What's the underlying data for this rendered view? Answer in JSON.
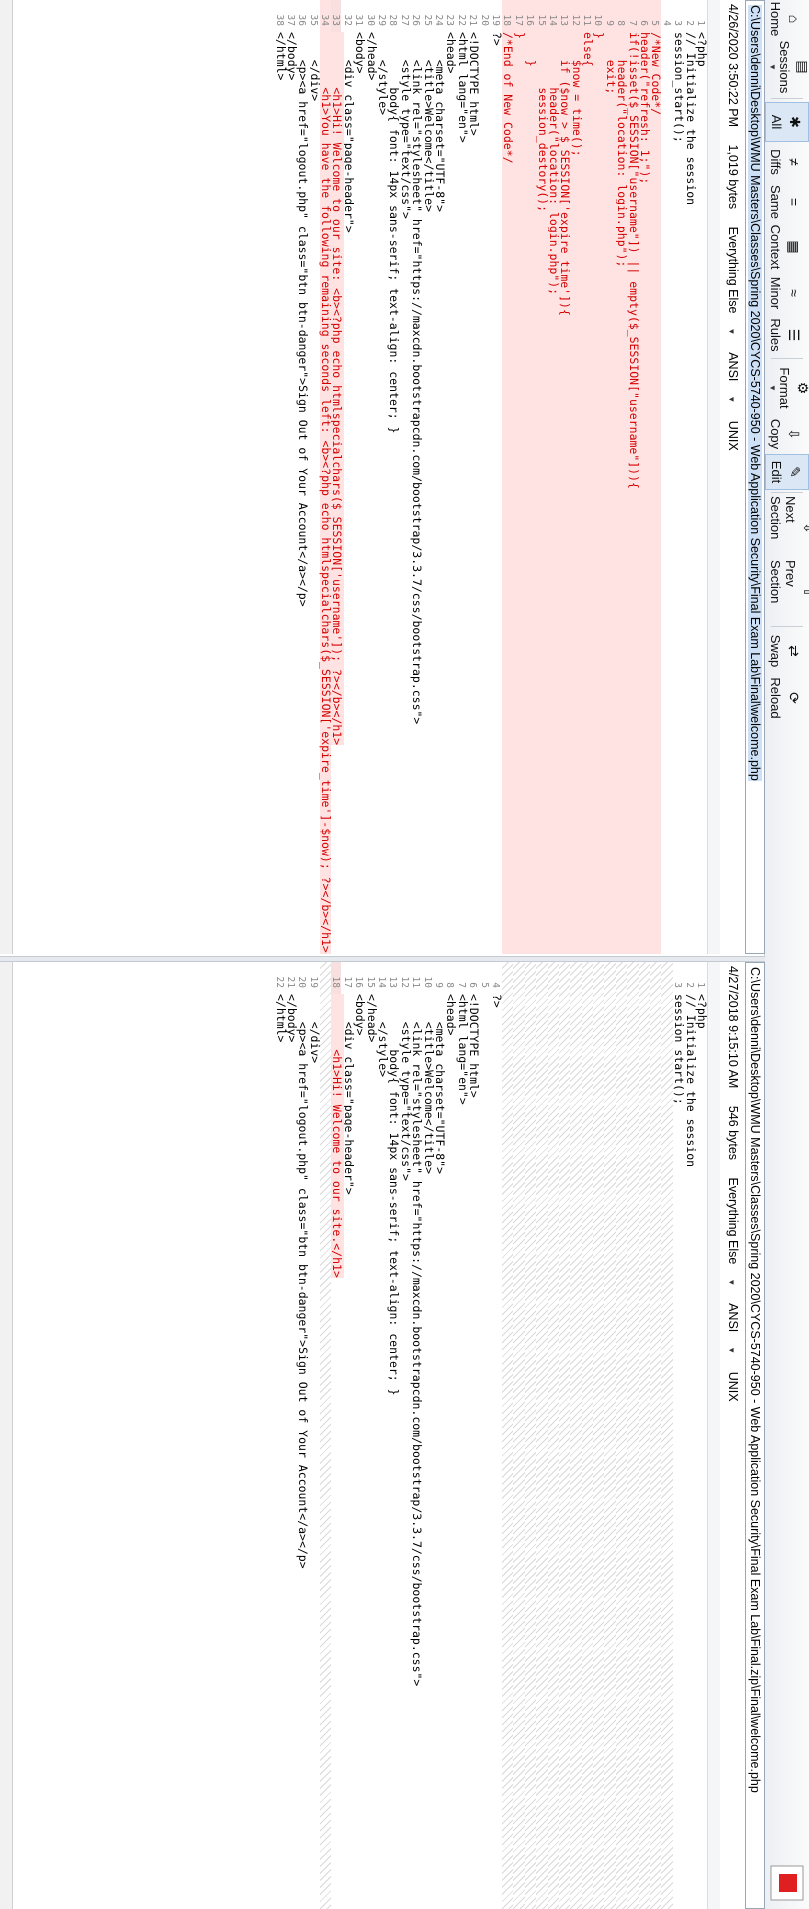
{
  "toolbar": {
    "items": [
      {
        "label": "Home",
        "icon": "home-icon"
      },
      {
        "label": "Sessions",
        "icon": "sessions-icon",
        "caret": true
      },
      {
        "label": "All",
        "icon": "asterisk-icon",
        "active": true
      },
      {
        "label": "Diffs",
        "icon": "diffs-icon"
      },
      {
        "label": "Same",
        "icon": "same-icon"
      },
      {
        "label": "Context",
        "icon": "context-icon"
      },
      {
        "label": "Minor",
        "icon": "minor-icon"
      },
      {
        "label": "Rules",
        "icon": "rules-icon"
      },
      {
        "label": "Format",
        "icon": "format-icon",
        "caret": true
      },
      {
        "label": "Copy",
        "icon": "copy-icon"
      },
      {
        "label": "Edit",
        "icon": "edit-icon",
        "active": true
      },
      {
        "label": "Next Section",
        "icon": "next-section-icon"
      },
      {
        "label": "Prev Section",
        "icon": "prev-section-icon"
      },
      {
        "label": "Swap",
        "icon": "swap-icon"
      },
      {
        "label": "Reload",
        "icon": "reload-icon"
      }
    ]
  },
  "left": {
    "path": "C:\\Users\\denni\\Desktop\\WMU Masters\\Classes\\Spring 2020\\CYCS-5740-950 - Web Application Security\\Final Exam Lab\\Final\\welcome.php",
    "date": "4/26/2020 3:50:22 PM",
    "size": "1,019 bytes",
    "filter": "Everything Else",
    "encoding": "ANSI",
    "lineending": "UNIX",
    "lines": [
      {
        "n": "1",
        "t": "<?php",
        "k": ""
      },
      {
        "n": "2",
        "t": "// Initialize the session",
        "k": ""
      },
      {
        "n": "3",
        "t": "session_start();",
        "k": ""
      },
      {
        "n": "4",
        "t": "",
        "k": ""
      },
      {
        "n": "5",
        "t": "/*New Code*/",
        "k": "del"
      },
      {
        "n": "6",
        "t": "header(\"refresh: 1;\");",
        "k": "del"
      },
      {
        "n": "7",
        "t": "if(!isset($_SESSION[\"username\"]) || empty($_SESSION[\"username\"])){",
        "k": "del"
      },
      {
        "n": "8",
        "t": "    header(\"location: login.php\");",
        "k": "del"
      },
      {
        "n": "9",
        "t": "    exit;",
        "k": "del"
      },
      {
        "n": "10",
        "t": "}",
        "k": "del"
      },
      {
        "n": "11",
        "t": "else{",
        "k": "del"
      },
      {
        "n": "12",
        "t": "    $now = time();",
        "k": "del"
      },
      {
        "n": "13",
        "t": "    if ($now > $_SESSION['expire_time']){",
        "k": "del"
      },
      {
        "n": "14",
        "t": "        header(\"location: login.php\");",
        "k": "del"
      },
      {
        "n": "15",
        "t": "        session_destory();",
        "k": "del"
      },
      {
        "n": "16",
        "t": "    }",
        "k": "del"
      },
      {
        "n": "17",
        "t": "}",
        "k": "del"
      },
      {
        "n": "18",
        "t": "/*End of New Code*/",
        "k": "del"
      },
      {
        "n": "19",
        "t": "?>",
        "k": ""
      },
      {
        "n": "20",
        "t": "",
        "k": ""
      },
      {
        "n": "21",
        "t": "<!DOCTYPE html>",
        "k": ""
      },
      {
        "n": "22",
        "t": "<html lang=\"en\">",
        "k": ""
      },
      {
        "n": "23",
        "t": "<head>",
        "k": ""
      },
      {
        "n": "24",
        "t": "    <meta charset=\"UTF-8\">",
        "k": ""
      },
      {
        "n": "25",
        "t": "    <title>Welcome</title>",
        "k": ""
      },
      {
        "n": "26",
        "t": "    <link rel=\"stylesheet\" href=\"https://maxcdn.bootstrapcdn.com/bootstrap/3.3.7/css/bootstrap.css\">",
        "k": ""
      },
      {
        "n": "27",
        "t": "    <style type=\"text/css\">",
        "k": ""
      },
      {
        "n": "28",
        "t": "        body{ font: 14px sans-serif; text-align: center; }",
        "k": ""
      },
      {
        "n": "29",
        "t": "    </style>",
        "k": ""
      },
      {
        "n": "30",
        "t": "</head>",
        "k": ""
      },
      {
        "n": "31",
        "t": "<body>",
        "k": ""
      },
      {
        "n": "32",
        "t": "    <div class=\"page-header\">",
        "k": ""
      },
      {
        "n": "33",
        "t": "        <h1>Hi! Welcome to our site: <b><?php echo htmlspecialchars($_SESSION['username']); ?></b></h1>",
        "k": "mod"
      },
      {
        "n": "34",
        "t": "        <h1>You have the following remaining seconds left: <b><?php echo htmlspecialchars($_SESSION['expire_time']-$now); ?></b></h1>",
        "k": "del"
      },
      {
        "n": "35",
        "t": "    </div>",
        "k": ""
      },
      {
        "n": "36",
        "t": "    <p><a href=\"logout.php\" class=\"btn btn-danger\">Sign Out of Your Account</a></p>",
        "k": ""
      },
      {
        "n": "37",
        "t": "</body>",
        "k": ""
      },
      {
        "n": "38",
        "t": "</html>",
        "k": ""
      }
    ]
  },
  "right": {
    "path": "C:\\Users\\denni\\Desktop\\WMU Masters\\Classes\\Spring 2020\\CYCS-5740-950 - Web Application Security\\Final Exam Lab\\Final.zip\\Final\\welcome.php",
    "date": "4/27/2018 9:15:10 AM",
    "size": "546 bytes",
    "filter": "Everything Else",
    "encoding": "ANSI",
    "lineending": "UNIX",
    "lines": [
      {
        "n": "1",
        "t": "<?php",
        "k": ""
      },
      {
        "n": "2",
        "t": "// Initialize the session",
        "k": ""
      },
      {
        "n": "3",
        "t": "session_start();",
        "k": ""
      },
      {
        "n": "",
        "t": "",
        "k": "hatch"
      },
      {
        "n": "",
        "t": "",
        "k": "hatch"
      },
      {
        "n": "",
        "t": "",
        "k": "hatch"
      },
      {
        "n": "",
        "t": "",
        "k": "hatch"
      },
      {
        "n": "",
        "t": "",
        "k": "hatch"
      },
      {
        "n": "",
        "t": "",
        "k": "hatch"
      },
      {
        "n": "",
        "t": "",
        "k": "hatch"
      },
      {
        "n": "",
        "t": "",
        "k": "hatch"
      },
      {
        "n": "",
        "t": "",
        "k": "hatch"
      },
      {
        "n": "",
        "t": "",
        "k": "hatch"
      },
      {
        "n": "",
        "t": "",
        "k": "hatch"
      },
      {
        "n": "",
        "t": "",
        "k": "hatch"
      },
      {
        "n": "",
        "t": "",
        "k": "hatch"
      },
      {
        "n": "",
        "t": "",
        "k": "hatch"
      },
      {
        "n": "",
        "t": "",
        "k": "hatch"
      },
      {
        "n": "4",
        "t": "?>",
        "k": ""
      },
      {
        "n": "5",
        "t": "",
        "k": ""
      },
      {
        "n": "6",
        "t": "<!DOCTYPE html>",
        "k": ""
      },
      {
        "n": "7",
        "t": "<html lang=\"en\">",
        "k": ""
      },
      {
        "n": "8",
        "t": "<head>",
        "k": ""
      },
      {
        "n": "9",
        "t": "    <meta charset=\"UTF-8\">",
        "k": ""
      },
      {
        "n": "10",
        "t": "    <title>Welcome</title>",
        "k": ""
      },
      {
        "n": "11",
        "t": "    <link rel=\"stylesheet\" href=\"https://maxcdn.bootstrapcdn.com/bootstrap/3.3.7/css/bootstrap.css\">",
        "k": ""
      },
      {
        "n": "12",
        "t": "    <style type=\"text/css\">",
        "k": ""
      },
      {
        "n": "13",
        "t": "        body{ font: 14px sans-serif; text-align: center; }",
        "k": ""
      },
      {
        "n": "14",
        "t": "    </style>",
        "k": ""
      },
      {
        "n": "15",
        "t": "</head>",
        "k": ""
      },
      {
        "n": "16",
        "t": "<body>",
        "k": ""
      },
      {
        "n": "17",
        "t": "    <div class=\"page-header\">",
        "k": ""
      },
      {
        "n": "18",
        "t": "        <h1>Hi! Welcome to our site.</h1>",
        "k": "mod"
      },
      {
        "n": "",
        "t": "",
        "k": "hatch"
      },
      {
        "n": "19",
        "t": "    </div>",
        "k": ""
      },
      {
        "n": "20",
        "t": "    <p><a href=\"logout.php\" class=\"btn btn-danger\">Sign Out of Your Account</a></p>",
        "k": ""
      },
      {
        "n": "21",
        "t": "</body>",
        "k": ""
      },
      {
        "n": "22",
        "t": "</html>",
        "k": ""
      }
    ]
  },
  "colors": {
    "deleted_bg": "#ffe3e3",
    "deleted_text": "#d40000",
    "selected_path": "#cde0f5"
  }
}
